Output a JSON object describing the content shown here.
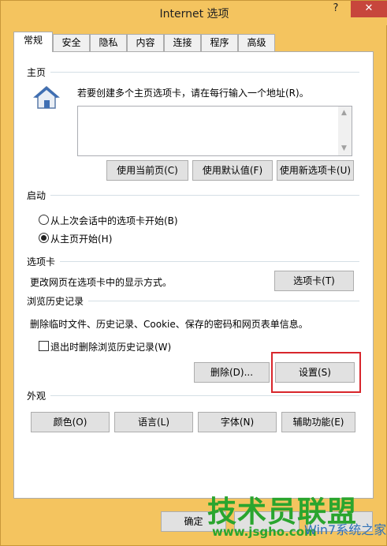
{
  "window": {
    "title": "Internet 选项",
    "help_label": "?",
    "close_label": "✕"
  },
  "tabs": [
    {
      "label": "常规",
      "active": true
    },
    {
      "label": "安全"
    },
    {
      "label": "隐私"
    },
    {
      "label": "内容"
    },
    {
      "label": "连接"
    },
    {
      "label": "程序"
    },
    {
      "label": "高级"
    }
  ],
  "home": {
    "group": "主页",
    "description": "若要创建多个主页选项卡，请在每行输入一个地址(R)。",
    "address_value": "",
    "use_current": "使用当前页(C)",
    "use_default": "使用默认值(F)",
    "use_new_tab": "使用新选项卡(U)",
    "icon": "house-icon"
  },
  "startup": {
    "group": "启动",
    "option_last_session": "从上次会话中的选项卡开始(B)",
    "option_home": "从主页开始(H)",
    "selected": "home"
  },
  "tabs_section": {
    "group": "选项卡",
    "description": "更改网页在选项卡中的显示方式。",
    "button": "选项卡(T)"
  },
  "history": {
    "group": "浏览历史记录",
    "description": "删除临时文件、历史记录、Cookie、保存的密码和网页表单信息。",
    "delete_on_exit": "退出时删除浏览历史记录(W)",
    "delete_on_exit_checked": false,
    "delete_button": "删除(D)...",
    "settings_button": "设置(S)",
    "highlight_color": "#d8262c"
  },
  "appearance": {
    "group": "外观",
    "colors": "颜色(O)",
    "languages": "语言(L)",
    "fonts": "字体(N)",
    "accessibility": "辅助功能(E)"
  },
  "footer": {
    "ok": "确定"
  },
  "watermark": {
    "brand": "技术员联盟",
    "url": "www.jsgho.com",
    "win_text": "Win7系统之家"
  }
}
